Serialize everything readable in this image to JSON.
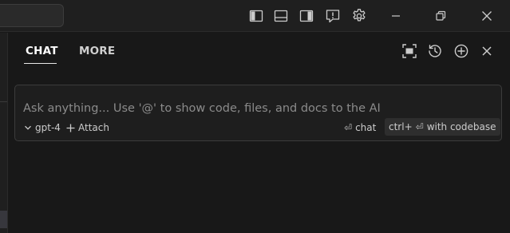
{
  "titlebar": {
    "icons": [
      "toggle-primary-sidebar-icon",
      "toggle-panel-icon",
      "toggle-secondary-sidebar-icon",
      "feedback-icon",
      "gear-icon",
      "minimize-icon",
      "restore-icon",
      "close-icon"
    ]
  },
  "panel": {
    "tabs": [
      {
        "label": "CHAT",
        "active": true
      },
      {
        "label": "MORE",
        "active": false
      }
    ],
    "actions": [
      "maximize-icon",
      "history-icon",
      "new-chat-icon",
      "close-panel-icon"
    ]
  },
  "chat": {
    "placeholder": "Ask anything... Use '@' to show code, files, and docs to the AI",
    "model": "gpt-4",
    "attach_label": "Attach",
    "send_chat_label": "chat",
    "codebase_label": "with codebase",
    "codebase_shortcut": "ctrl+"
  },
  "colors": {
    "background": "#181818",
    "titlebar": "#1f1f1f",
    "input_border": "#3c3c3c"
  }
}
